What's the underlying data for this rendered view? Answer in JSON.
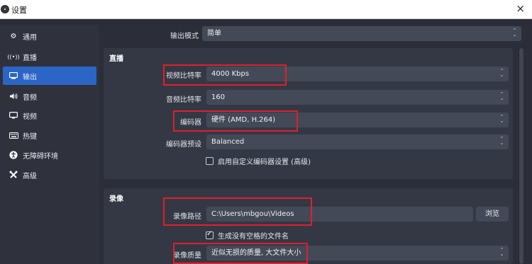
{
  "window": {
    "title": "设置",
    "close_glyph": "×"
  },
  "sidebar": {
    "items": [
      {
        "label": "通用",
        "icon": "⚙"
      },
      {
        "label": "直播",
        "icon": "((•))"
      },
      {
        "label": "输出",
        "icon": "▭",
        "active": true
      },
      {
        "label": "音频",
        "icon": "🔊"
      },
      {
        "label": "视频",
        "icon": "▢"
      },
      {
        "label": "热键",
        "icon": "⌨"
      },
      {
        "label": "无障碍环境",
        "icon": "♿"
      },
      {
        "label": "高级",
        "icon": "✂"
      }
    ]
  },
  "output_mode": {
    "label": "输出模式",
    "value": "简单"
  },
  "stream": {
    "title": "直播",
    "video_bitrate": {
      "label": "视频比特率",
      "value": "4000 Kbps"
    },
    "audio_bitrate": {
      "label": "音频比特率",
      "value": "160"
    },
    "encoder": {
      "label": "编码器",
      "value": "硬件 (AMD, H.264)"
    },
    "encoder_preset": {
      "label": "编码器预设",
      "value": "Balanced"
    },
    "custom_encoder_checkbox": {
      "label": "启用自定义编码器设置 (高级)",
      "checked": false
    }
  },
  "recording": {
    "title": "录像",
    "path": {
      "label": "录像路径",
      "value": "C:\\Users\\mbgou\\Videos",
      "browse_label": "浏览"
    },
    "no_space_checkbox": {
      "label": "生成没有空格的文件名",
      "checked": true
    },
    "quality": {
      "label": "录像质量",
      "value": "近似无损的质量, 大文件大小"
    }
  },
  "colors": {
    "accent": "#2b65c6",
    "annotation_red": "#e0202a",
    "background": "#2b2e38"
  }
}
